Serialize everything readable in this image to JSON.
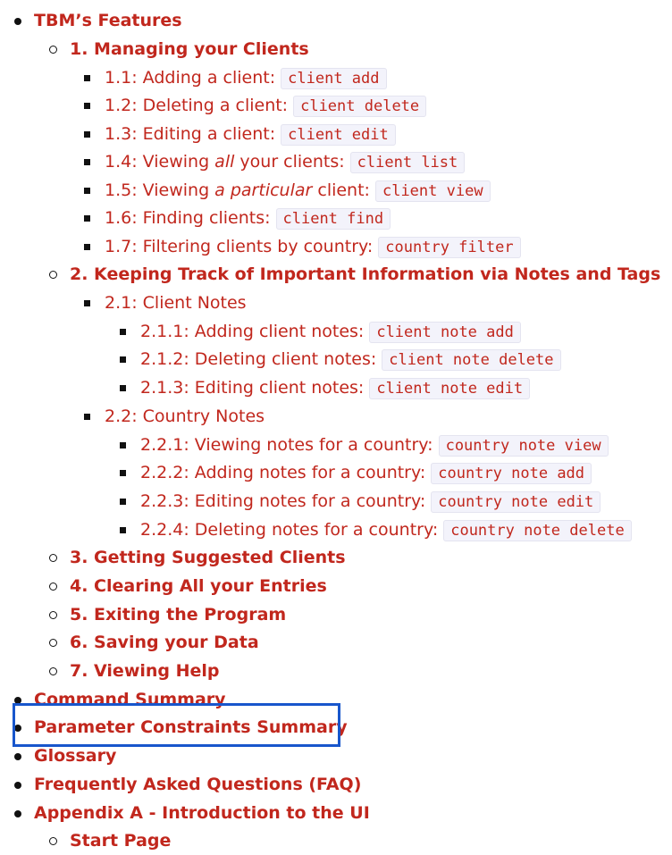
{
  "toc": {
    "features": {
      "label": "TBM’s Features",
      "managing": {
        "label": "1. Managing your Clients",
        "items": [
          {
            "prefix": "1.1: Adding a client:",
            "code": "client add"
          },
          {
            "prefix": "1.2: Deleting a client:",
            "code": "client delete"
          },
          {
            "prefix": "1.3: Editing a client:",
            "code": "client edit"
          },
          {
            "pre": "1.4: Viewing ",
            "em": "all",
            "post": " your clients:",
            "code": "client list"
          },
          {
            "pre": "1.5: Viewing ",
            "em": "a particular",
            "post": " client:",
            "code": "client view"
          },
          {
            "prefix": "1.6: Finding clients:",
            "code": "client find"
          },
          {
            "prefix": "1.7: Filtering clients by country:",
            "code": "country filter"
          }
        ]
      },
      "notes": {
        "label": "2. Keeping Track of Important Information via Notes and Tags",
        "client_notes": {
          "label": "2.1: Client Notes",
          "items": [
            {
              "prefix": "2.1.1: Adding client notes:",
              "code": "client note add"
            },
            {
              "prefix": "2.1.2: Deleting client notes:",
              "code": "client note delete"
            },
            {
              "prefix": "2.1.3: Editing client notes:",
              "code": "client note edit"
            }
          ]
        },
        "country_notes": {
          "label": "2.2: Country Notes",
          "items": [
            {
              "prefix": "2.2.1: Viewing notes for a country:",
              "code": "country note view"
            },
            {
              "prefix": "2.2.2: Adding notes for a country:",
              "code": "country note add"
            },
            {
              "prefix": "2.2.3: Editing notes for a country:",
              "code": "country note edit"
            },
            {
              "prefix": "2.2.4: Deleting notes for a country:",
              "code": "country note delete"
            }
          ]
        }
      },
      "sections": [
        "3. Getting Suggested Clients",
        "4. Clearing All your Entries",
        "5. Exiting the Program",
        "6. Saving your Data",
        "7. Viewing Help"
      ]
    },
    "top_level": [
      "Command Summary",
      "Parameter Constraints Summary",
      "Glossary",
      "Frequently Asked Questions (FAQ)",
      "Appendix A - Introduction to the UI"
    ],
    "cut_off": "Start Page"
  },
  "colors": {
    "link": "#c1271d",
    "highlight_border": "#1856cc"
  }
}
